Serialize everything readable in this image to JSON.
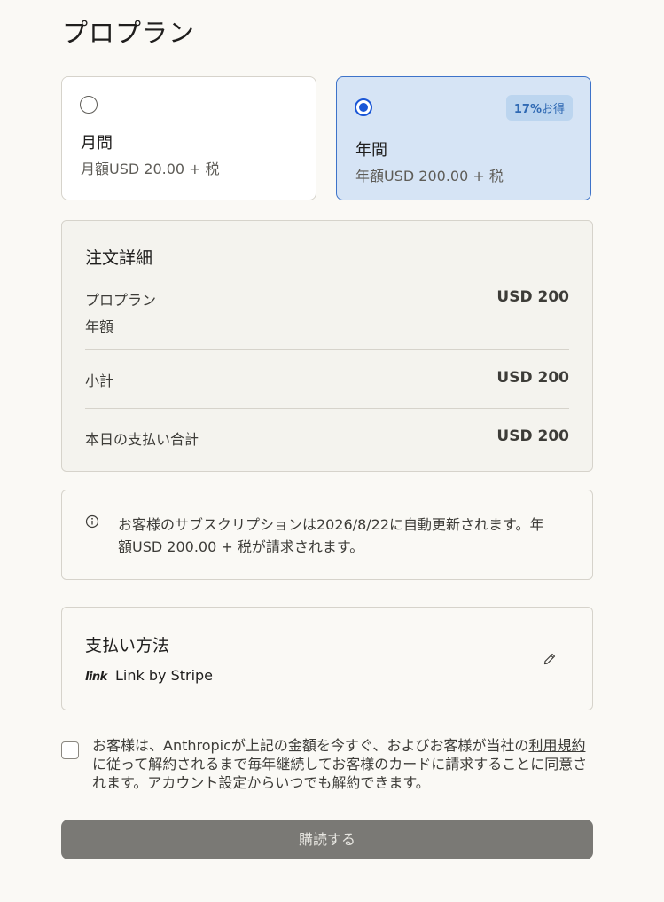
{
  "page": {
    "title": "プロプラン"
  },
  "plans": {
    "monthly": {
      "name": "月間",
      "price": "月額USD 20.00 + 税",
      "selected": false
    },
    "yearly": {
      "name": "年間",
      "price": "年額USD 200.00 + 税",
      "selected": true,
      "badge_percent": "17%",
      "badge_suffix": "お得"
    }
  },
  "order": {
    "title": "注文詳細",
    "plan_label": "プロプラン",
    "plan_sub": "年額",
    "plan_amount": "USD 200",
    "subtotal_label": "小計",
    "subtotal_amount": "USD 200",
    "total_label": "本日の支払い合計",
    "total_amount": "USD 200"
  },
  "notice": {
    "icon": "info-icon",
    "text": "お客様のサブスクリプションは2026/8/22に自動更新されます。年額USD 200.00 + 税が請求されます。"
  },
  "payment": {
    "title": "支払い方法",
    "logo_text": "link",
    "method_name": "Link by Stripe",
    "edit_icon": "pencil-icon"
  },
  "consent": {
    "text_before": "お客様は、Anthropicが上記の金額を今すぐ、およびお客様が当社の",
    "terms_link": "利用規約",
    "text_after": "に従って解約されるまで毎年継続してお客様のカードに請求することに同意されます。アカウント設定からいつでも解約できます。",
    "checked": false
  },
  "subscribe_button": {
    "label": "購読する",
    "disabled": true
  },
  "colors": {
    "background": "#faf9f5",
    "selected_card": "#d6e4f5",
    "selected_border": "#3d73c9",
    "radio_accent": "#1a56d6",
    "button_disabled": "#7a7975"
  }
}
